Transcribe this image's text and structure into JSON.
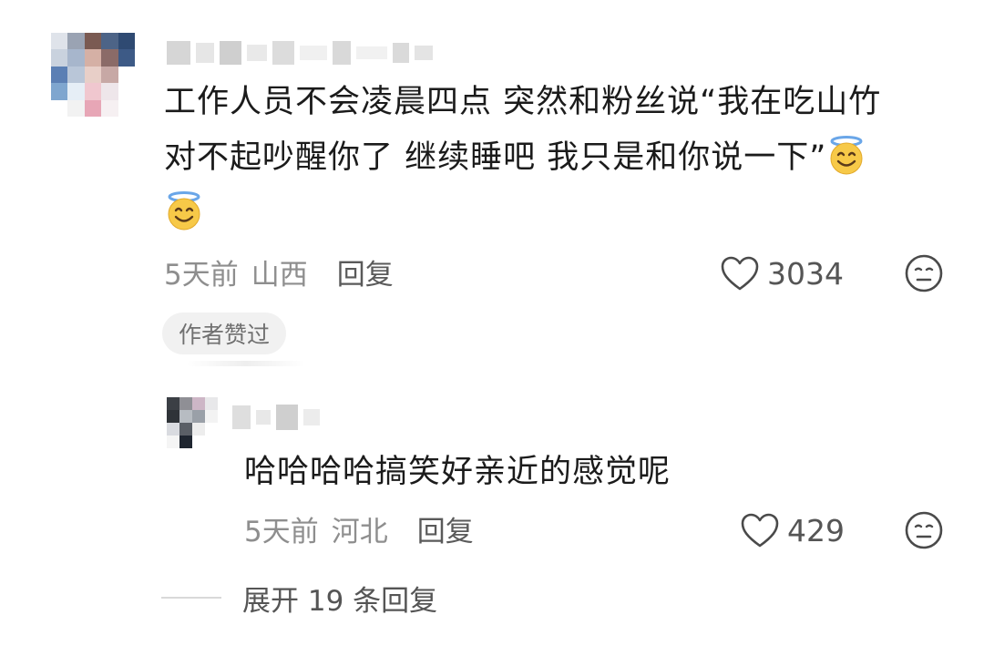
{
  "comment": {
    "text_line1": "工作人员不会凌晨四点 突然和粉丝说“我在吃山竹",
    "text_line2": "对不起吵醒你了 继续睡吧 我只是和你说一下”",
    "emoji_name": "smiling-face-with-halo",
    "time": "5天前",
    "location": "山西",
    "reply_label": "回复",
    "like_count": "3034",
    "author_liked": "作者赞过"
  },
  "reply": {
    "text": "哈哈哈哈搞笑好亲近的感觉呢",
    "time": "5天前",
    "location": "河北",
    "reply_label": "回复",
    "like_count": "429"
  },
  "expand": {
    "label": "展开 19 条回复"
  },
  "icons": {
    "like": "heart-outline-icon",
    "dislike": "neutral-face-icon",
    "emoji": "smiling-face-with-halo"
  },
  "colors": {
    "text": "#1b1b1b",
    "meta": "#8e8e8e",
    "pill_bg": "#f1f1f1"
  }
}
